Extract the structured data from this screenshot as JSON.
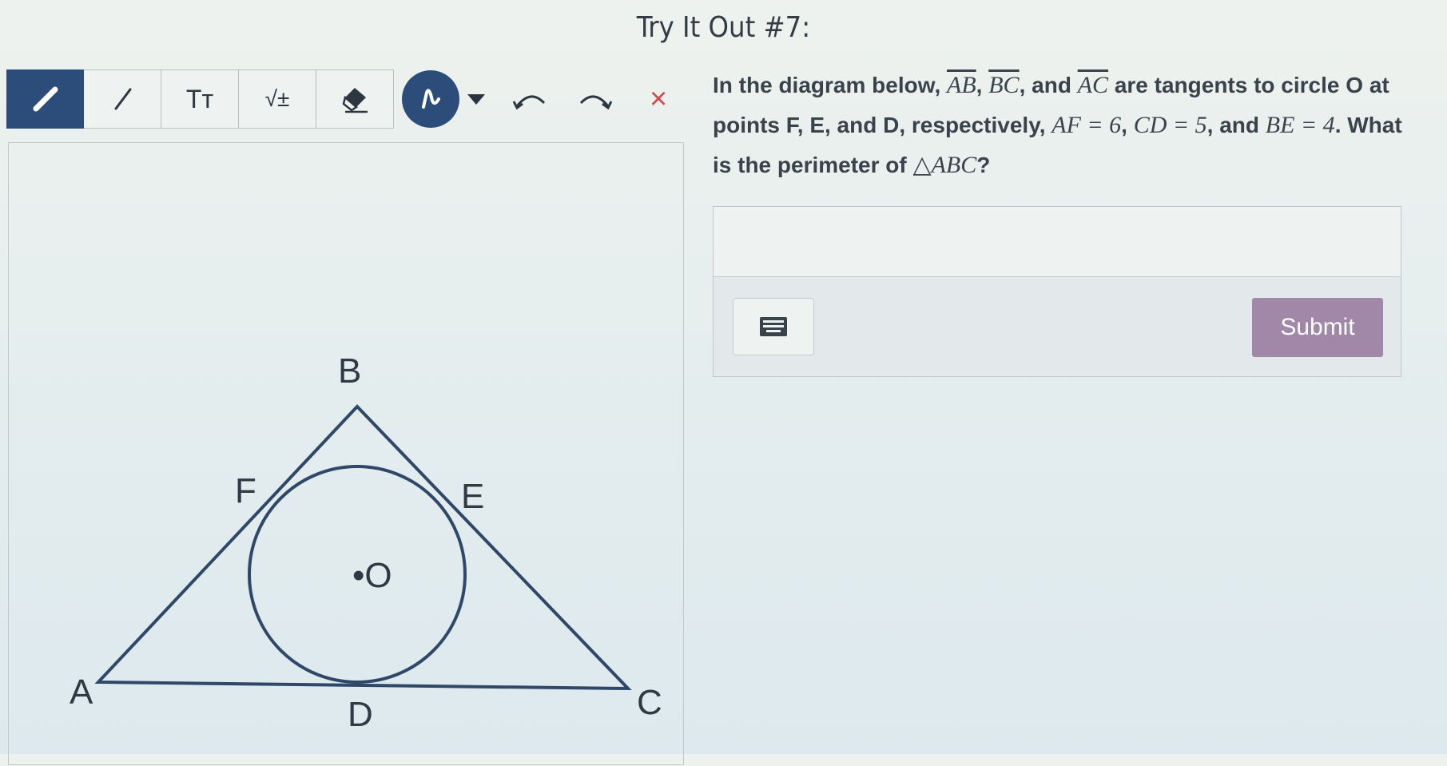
{
  "page": {
    "title": "Try It Out #7:"
  },
  "toolbar": {
    "tools": [
      {
        "name": "pencil-icon"
      },
      {
        "name": "line-icon"
      },
      {
        "name": "text-tool-icon",
        "label": "Tт"
      },
      {
        "name": "math-tool-icon",
        "label": "√±"
      },
      {
        "name": "eraser-icon"
      },
      {
        "name": "curve-tool-icon"
      },
      {
        "name": "chevron-down-icon"
      },
      {
        "name": "undo-icon"
      },
      {
        "name": "redo-icon"
      },
      {
        "name": "close-icon",
        "label": "×"
      }
    ]
  },
  "question": {
    "p1": "In the diagram below, ",
    "ab": "AB",
    "sep1": ", ",
    "bc": "BC",
    "p2": ", and ",
    "ac": "AC",
    "p3": " are tangents to circle O at points F, E, and D, respectively, ",
    "af": "AF = 6",
    "sep2": ", ",
    "cd": "CD = 5",
    "p4": ", and ",
    "be": "BE = 4",
    "p5": ". What is the perimeter of ",
    "tri": "△ABC",
    "p6": "?"
  },
  "diagram": {
    "labels": {
      "A": "A",
      "B": "B",
      "C": "C",
      "D": "D",
      "E": "E",
      "F": "F",
      "O": "•O"
    }
  },
  "answer": {
    "value": "",
    "submit_label": "Submit",
    "keyboard_icon": "keyboard-icon"
  },
  "colors": {
    "accent": "#2c4c7a",
    "submit": "#a188a8",
    "close": "#d04a4a"
  }
}
